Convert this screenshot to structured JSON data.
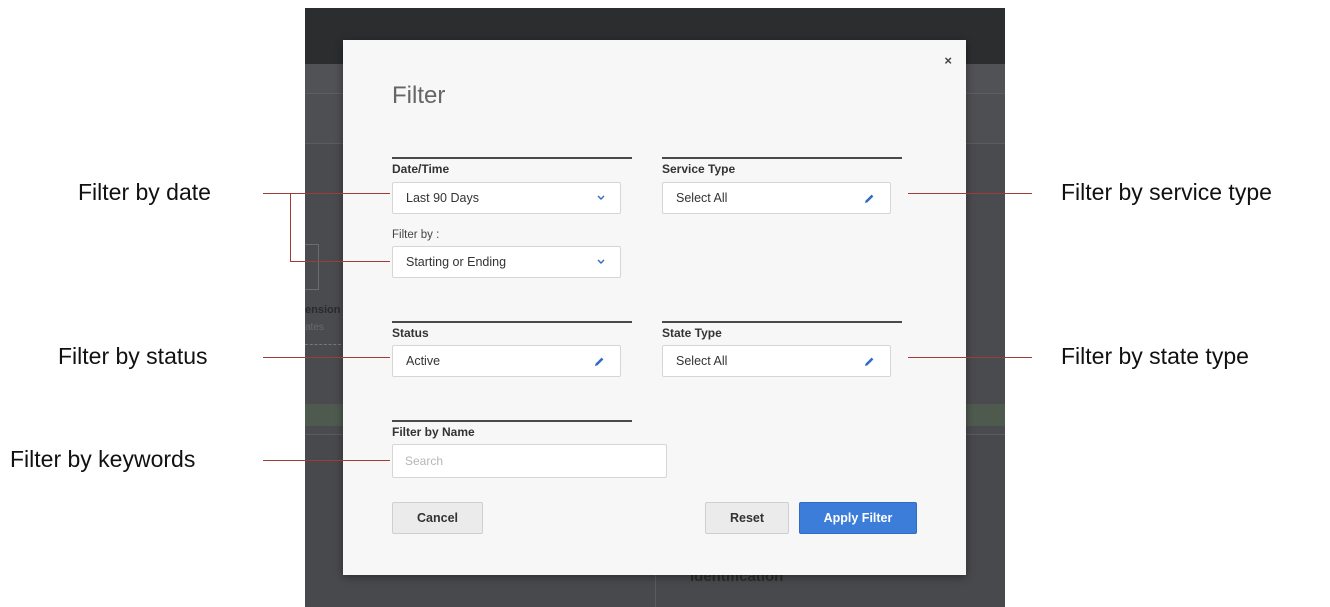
{
  "modal": {
    "title": "Filter",
    "close_label": "×",
    "datetime": {
      "label": "Date/Time",
      "value": "Last 90 Days",
      "filter_by_label": "Filter by :",
      "filter_by_value": "Starting or Ending"
    },
    "service_type": {
      "label": "Service Type",
      "value": "Select All"
    },
    "status": {
      "label": "Status",
      "value": "Active"
    },
    "state_type": {
      "label": "State Type",
      "value": "Select All"
    },
    "name_filter": {
      "label": "Filter by Name",
      "placeholder": "Search",
      "value": ""
    },
    "buttons": {
      "cancel": "Cancel",
      "reset": "Reset",
      "apply": "Apply Filter"
    }
  },
  "background_app": {
    "truncated_label": "ension",
    "truncated_sub": "ates",
    "section_heading": "Identification"
  },
  "annotations": {
    "date": "Filter by date",
    "status": "Filter by status",
    "keywords": "Filter by keywords",
    "service_type": "Filter by service type",
    "state_type": "Filter by state type"
  },
  "icons": {
    "dropdown": "chevron-down-icon",
    "edit": "pencil-icon",
    "close": "close-icon"
  },
  "colors": {
    "primary_button": "#3b7dd8",
    "icon_accent": "#2f6cc2",
    "annotation_line": "#a33a3a",
    "overlay": "#4a4b4e"
  }
}
